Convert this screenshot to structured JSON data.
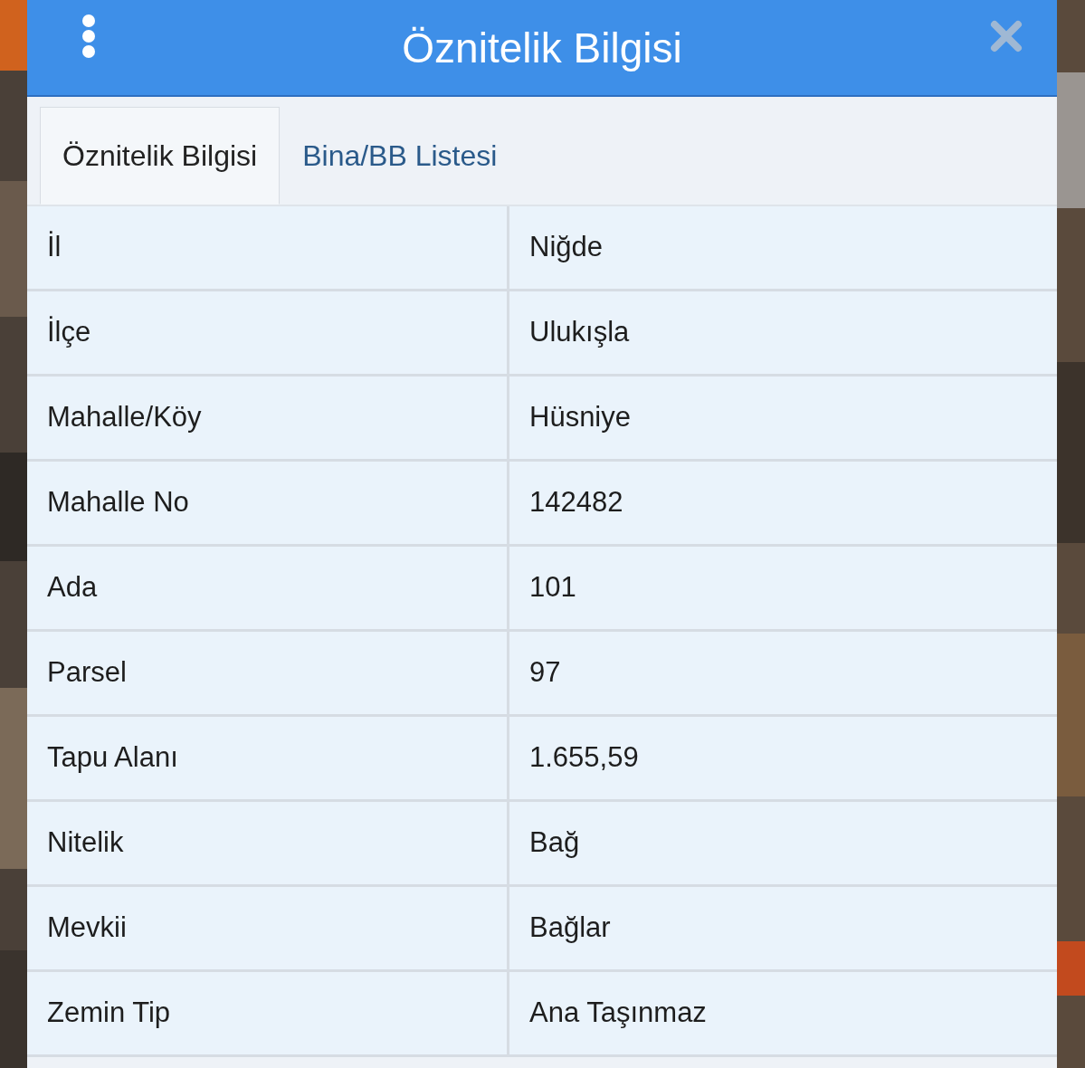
{
  "window": {
    "title": "Öznitelik Bilgisi"
  },
  "tabs": [
    {
      "label": "Öznitelik Bilgisi",
      "selected": true
    },
    {
      "label": "Bina/BB Listesi",
      "selected": false
    }
  ],
  "rows": [
    {
      "label": "İl",
      "value": "Niğde"
    },
    {
      "label": "İlçe",
      "value": "Ulukışla"
    },
    {
      "label": "Mahalle/Köy",
      "value": "Hüsniye"
    },
    {
      "label": "Mahalle No",
      "value": "142482"
    },
    {
      "label": "Ada",
      "value": "101"
    },
    {
      "label": "Parsel",
      "value": "97"
    },
    {
      "label": "Tapu Alanı",
      "value": "1.655,59"
    },
    {
      "label": "Nitelik",
      "value": "Bağ"
    },
    {
      "label": "Mevkii",
      "value": "Bağlar"
    },
    {
      "label": "Zemin Tip",
      "value": "Ana Taşınmaz"
    }
  ]
}
